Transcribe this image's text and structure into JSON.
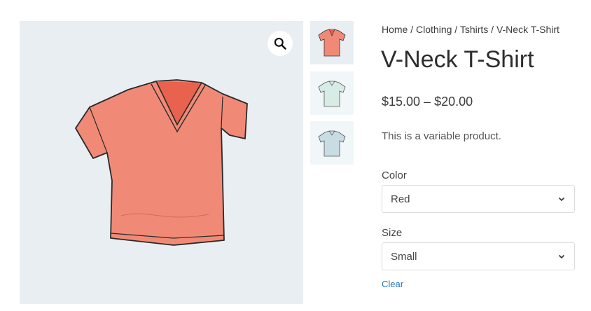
{
  "gallery": {
    "zoom_icon": "magnifier-icon",
    "main_color": "#f08a76",
    "thumbnails": [
      {
        "name": "red-shirt-thumbnail",
        "color": "#f08a76"
      },
      {
        "name": "mint-shirt-thumbnail",
        "color": "#d8ece6"
      },
      {
        "name": "blue-shirt-thumbnail",
        "color": "#c7dde3"
      }
    ]
  },
  "breadcrumb": {
    "home": "Home",
    "sep1": " / ",
    "clothing": "Clothing",
    "sep2": " / ",
    "tshirts": "Tshirts",
    "sep3": " / ",
    "current": "V-Neck T-Shirt"
  },
  "product": {
    "title": "V-Neck T-Shirt",
    "price": "$15.00 – $20.00",
    "description": "This is a variable product."
  },
  "variations": {
    "color_label": "Color",
    "color_value": "Red",
    "size_label": "Size",
    "size_value": "Small",
    "clear_label": "Clear"
  },
  "colors": {
    "link": "#1e73be",
    "image_bg": "#e9eef3"
  }
}
